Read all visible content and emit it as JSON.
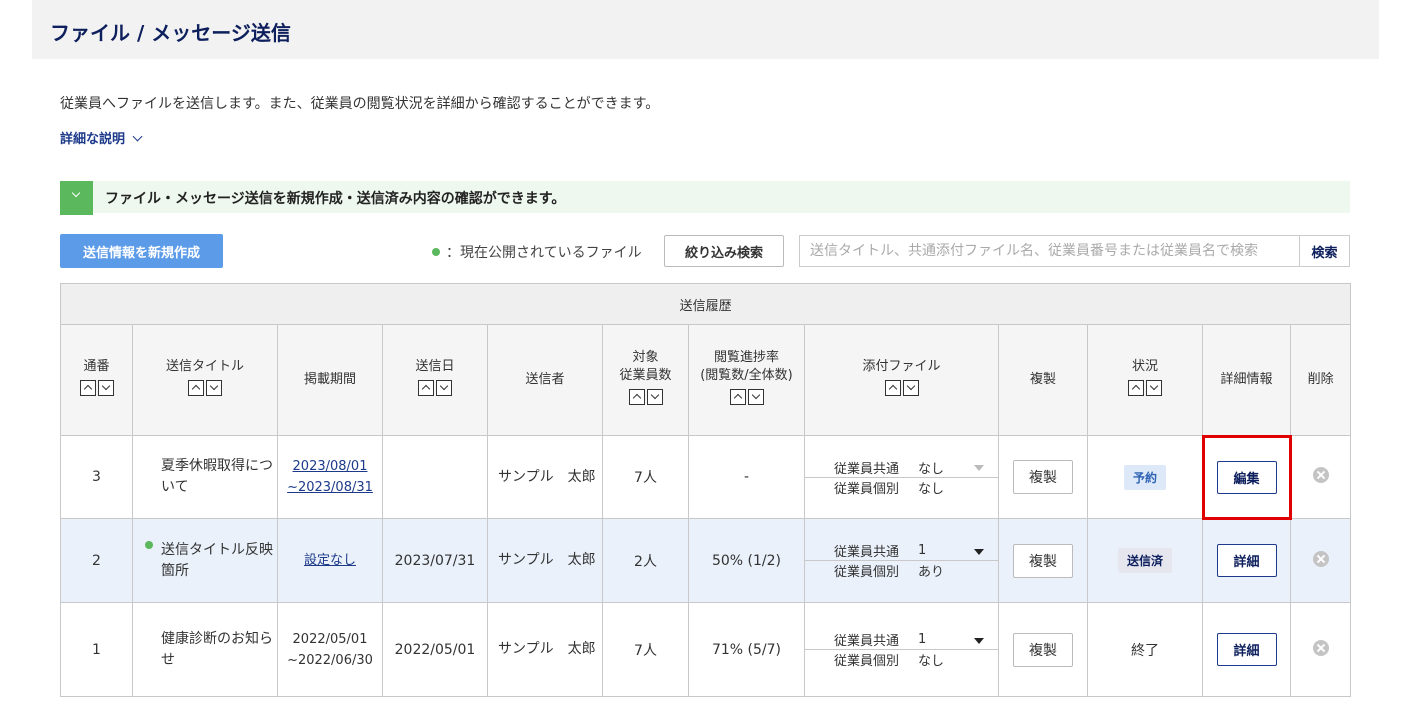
{
  "page": {
    "title": "ファイル / メッセージ送信",
    "description": "従業員へファイルを送信します。また、従業員の閲覧状況を詳細から確認することができます。",
    "details_link": "詳細な説明"
  },
  "banner": {
    "text": "ファイル・メッセージ送信を新規作成・送信済み内容の確認ができます。"
  },
  "toolbar": {
    "new_button": "送信情報を新規作成",
    "legend_text": "：現在公開されているファイル",
    "filter_button": "絞り込み検索",
    "search_placeholder": "送信タイトル、共通添付ファイル名、従業員番号または従業員名で検索",
    "search_button": "検索"
  },
  "table": {
    "caption": "送信履歴",
    "headers": {
      "no": "通番",
      "title": "送信タイトル",
      "period": "掲載期間",
      "date": "送信日",
      "sender": "送信者",
      "targets": "対象\n従業員数",
      "progress": "閲覧進捗率\n(閲覧数/全体数)",
      "attachments": "添付ファイル",
      "copy": "複製",
      "status": "状況",
      "detail": "詳細情報",
      "delete": "削除"
    },
    "rows": [
      {
        "no": "3",
        "title": "夏季休暇取得について",
        "period": "2023/08/01\n~2023/08/31",
        "date": "",
        "sender": "サンプル　太郎",
        "targets": "7人",
        "progress": "-",
        "common_label": "従業員共通",
        "common_value": "なし",
        "individual_label": "従業員個別",
        "individual_value": "なし",
        "copy": "複製",
        "status": "予約",
        "action": "編集"
      },
      {
        "no": "2",
        "title": "送信タイトル反映箇所",
        "period": "設定なし",
        "date": "2023/07/31",
        "sender": "サンプル　太郎",
        "targets": "2人",
        "progress": "50% (1/2)",
        "common_label": "従業員共通",
        "common_value": "1",
        "individual_label": "従業員個別",
        "individual_value": "あり",
        "copy": "複製",
        "status": "送信済",
        "action": "詳細"
      },
      {
        "no": "1",
        "title": "健康診断のお知らせ",
        "period": "2022/05/01\n~2022/06/30",
        "date": "2022/05/01",
        "sender": "サンプル　太郎",
        "targets": "7人",
        "progress": "71% (5/7)",
        "common_label": "従業員共通",
        "common_value": "1",
        "individual_label": "従業員個別",
        "individual_value": "なし",
        "copy": "複製",
        "status": "終了",
        "action": "詳細"
      }
    ]
  },
  "colors": {
    "accent": "#5b9be8",
    "public_dot": "#5cb85c",
    "highlight": "#e00000",
    "title": "#0d1f5c"
  }
}
